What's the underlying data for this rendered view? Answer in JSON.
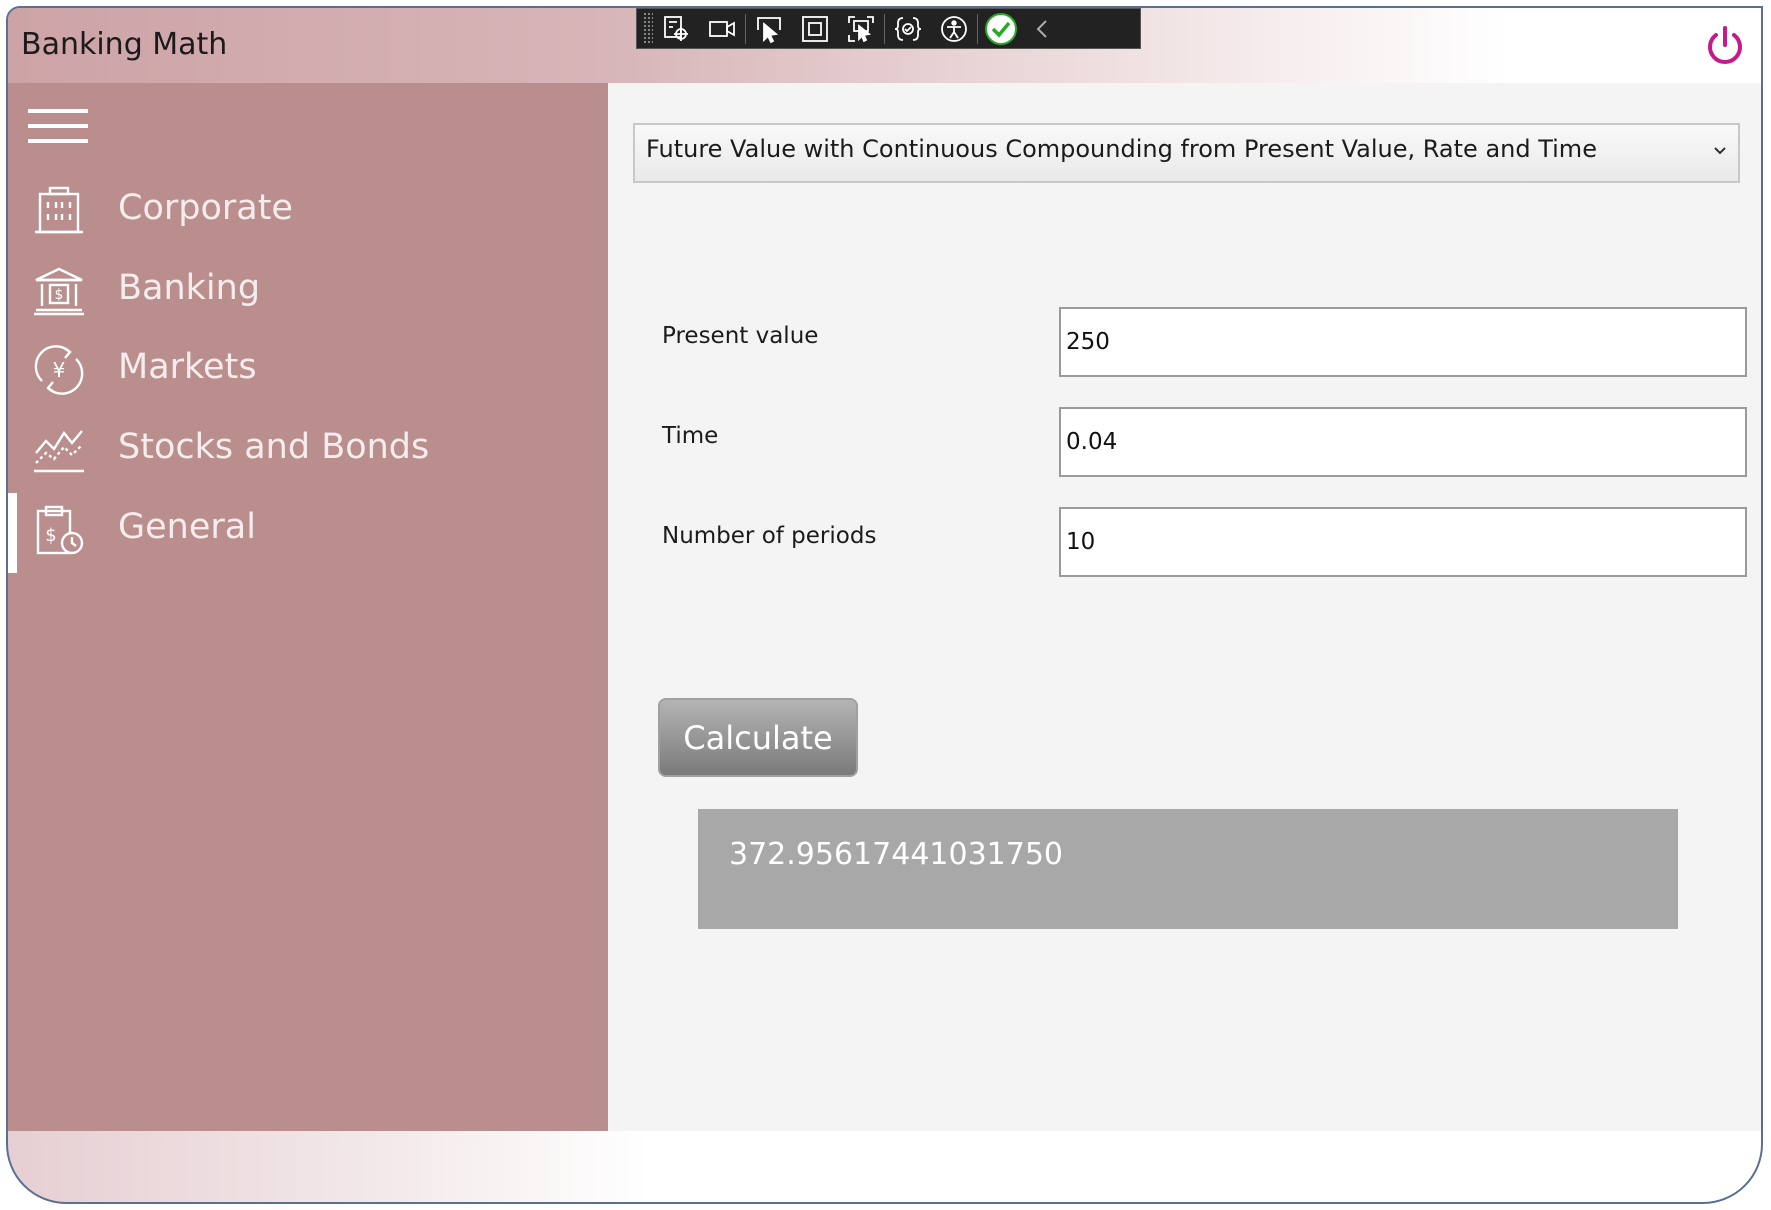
{
  "app": {
    "title": "Banking Math"
  },
  "sidebar": {
    "items": [
      {
        "label": "Corporate",
        "icon": "building-icon"
      },
      {
        "label": "Banking",
        "icon": "bank-icon"
      },
      {
        "label": "Markets",
        "icon": "currency-exchange-icon"
      },
      {
        "label": "Stocks and Bonds",
        "icon": "stock-chart-icon"
      },
      {
        "label": "General",
        "icon": "clipboard-money-icon"
      }
    ],
    "selected": "General"
  },
  "calculator": {
    "formula": "Future Value with Continuous Compounding from Present Value, Rate and Time",
    "fields": [
      {
        "label": "Present value",
        "value": "250"
      },
      {
        "label": "Time",
        "value": "0.04"
      },
      {
        "label": "Number of periods",
        "value": "10"
      }
    ],
    "button_label": "Calculate",
    "result": "372.95617441031750"
  },
  "colors": {
    "sidebar": "#bb8e8e",
    "content": "#f4f4f4",
    "power": "#c41a8a",
    "result": "#a8a8a8"
  }
}
